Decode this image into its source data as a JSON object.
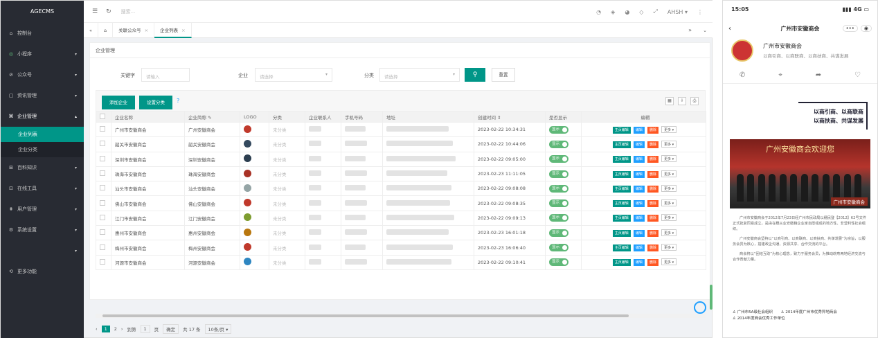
{
  "app": {
    "title": "AGECMS"
  },
  "sidebar": {
    "items": [
      {
        "icon": "home-icon",
        "glyph": "⌂",
        "label": "控制台",
        "arrow": ""
      },
      {
        "icon": "miniprogram-icon",
        "glyph": "◎",
        "label": "小程序",
        "arrow": "▾"
      },
      {
        "icon": "official-account-icon",
        "glyph": "⊘",
        "label": "公众号",
        "arrow": "▾"
      },
      {
        "icon": "news-icon",
        "glyph": "▢",
        "label": "资讯管理",
        "arrow": "▾"
      },
      {
        "icon": "enterprise-icon",
        "glyph": "⌘",
        "label": "企业管理",
        "arrow": "▴"
      }
    ],
    "subitems": [
      {
        "label": "企业列表",
        "active": true
      },
      {
        "label": "企业分类",
        "active": false
      }
    ],
    "items2": [
      {
        "icon": "grid-icon",
        "glyph": "⊞",
        "label": "百科知识",
        "arrow": "▾"
      },
      {
        "icon": "tools-icon",
        "glyph": "⊡",
        "label": "在线工具",
        "arrow": "▾"
      },
      {
        "icon": "users-icon",
        "glyph": "⩩",
        "label": "用户管理",
        "arrow": "▾"
      },
      {
        "icon": "settings-icon",
        "glyph": "⚙",
        "label": "系统设置",
        "arrow": "▾"
      },
      {
        "icon": "blank-icon",
        "glyph": "",
        "label": "",
        "arrow": "▾"
      },
      {
        "icon": "more-icon",
        "glyph": "⟲",
        "label": "更多功能",
        "arrow": ""
      }
    ]
  },
  "topbar": {
    "search_placeholder": "搜索...",
    "user": "AHSH ▾"
  },
  "tabs": [
    {
      "label": "关联公众号"
    },
    {
      "label": "企业列表",
      "active": true
    }
  ],
  "breadcrumb": "企业管理",
  "filters": {
    "keyword_label": "关键字",
    "keyword_placeholder": "请输入",
    "enterprise_label": "企业",
    "enterprise_placeholder": "请选择",
    "category_label": "分类",
    "category_placeholder": "请选择",
    "reset_label": "重置"
  },
  "toolbar": {
    "add_label": "添加企业",
    "category_label": "设置分类",
    "help": "?"
  },
  "table": {
    "headers": [
      "",
      "企业名称",
      "企业简称 ✎",
      "LOGO",
      "分类",
      "企业联系人",
      "手机号码",
      "地址",
      "创建时间 ⇕",
      "是否显示",
      "编辑"
    ],
    "rows": [
      {
        "name": "广州市安徽商会",
        "short": "广州安徽商会",
        "cat": "未分类",
        "time": "2023-02-22 10:34:31",
        "logo": "#c0392b"
      },
      {
        "name": "韶关市安徽商会",
        "short": "韶关安徽商会",
        "cat": "未分类",
        "time": "2023-02-22 10:44:06",
        "logo": "#34495e"
      },
      {
        "name": "深圳市安徽商会",
        "short": "深圳安徽商会",
        "cat": "未分类",
        "time": "2023-02-22 09:05:00",
        "logo": "#2c3e50"
      },
      {
        "name": "珠海市安徽商会",
        "short": "珠海安徽商会",
        "cat": "未分类",
        "time": "2023-02-23 11:11:05",
        "logo": "#a93226"
      },
      {
        "name": "汕头市安徽商会",
        "short": "汕头安徽商会",
        "cat": "未分类",
        "time": "2023-02-22 09:08:08",
        "logo": "#95a5a6"
      },
      {
        "name": "佛山市安徽商会",
        "short": "佛山安徽商会",
        "cat": "未分类",
        "time": "2023-02-22 09:08:35",
        "logo": "#c0392b"
      },
      {
        "name": "江门市安徽商会",
        "short": "江门安徽商会",
        "cat": "未分类",
        "time": "2023-02-22 09:09:13",
        "logo": "#7d9c2f"
      },
      {
        "name": "惠州市安徽商会",
        "short": "惠州安徽商会",
        "cat": "未分类",
        "time": "2023-02-23 16:01:18",
        "logo": "#b9770e"
      },
      {
        "name": "梅州市安徽商会",
        "short": "梅州安徽商会",
        "cat": "未分类",
        "time": "2023-02-23 16:06:40",
        "logo": "#c0392b"
      },
      {
        "name": "河源市安徽商会",
        "short": "河源安徽商会",
        "cat": "未分类",
        "time": "2023-02-22 09:10:41",
        "logo": "#2e86c1"
      }
    ],
    "toggle_label": "显示",
    "actions": {
      "home": "主页编辑",
      "edit": "编辑",
      "delete": "删除",
      "more": "更多 ▾"
    }
  },
  "pager": {
    "current": "1",
    "next": "2",
    "goto": "到第",
    "page_input": "1",
    "page_unit": "页",
    "confirm": "确定",
    "total": "共 17 条",
    "per_page": "10条/页 ▾"
  },
  "phone": {
    "time": "15:05",
    "signal": "4G",
    "title": "广州市安徽商会",
    "profile_name": "广州市安徽商会",
    "slogan": "以商引商、以商联商、以商扶商、共谋发展",
    "motto_1": "以商引商、以商联商",
    "motto_2": "以商扶商、共谋发展",
    "welcome": "广州安徽商会欢迎您",
    "badge": "广州市安徽商会",
    "para_1": "广州市安徽商会于2012年7月23日经广州市民政局以穗民登【2012】62号文件正式批复同意成立，是由在穗从业安徽籍企业家自愿组成的地方性、非营利性社会组织。",
    "para_2": "广州安徽商会坚持以“以商引商、以商联商、以商扶商、共谋发展”为宗旨，以服务会员为核心，搭建政企沟通、资源共享、合作交流的平台。",
    "para_3": "商会将以“团结互助”为核心理念，致力于服务会员，为推动皖粤两地经济交流与合作贡献力量。",
    "honor_1": "广州市5A级社会组织",
    "honor_2": "2014年度广州市优秀异地商会",
    "honor_3": "2014年度商会优秀工作单位"
  }
}
